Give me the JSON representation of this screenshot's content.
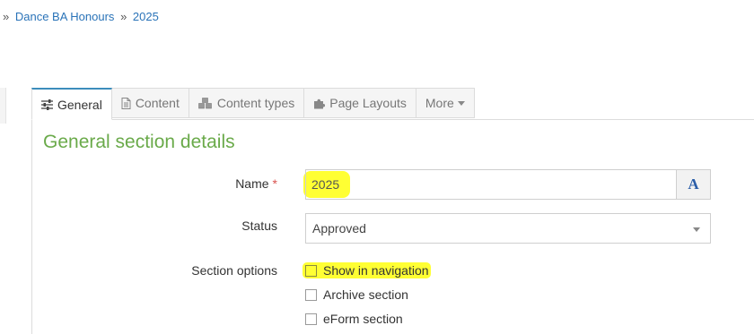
{
  "breadcrumb": {
    "separator": "»",
    "items": [
      "Dance BA Honours",
      "2025"
    ]
  },
  "tabs": [
    {
      "label": "General",
      "icon": "sliders-icon",
      "active": true
    },
    {
      "label": "Content",
      "icon": "file-icon",
      "active": false
    },
    {
      "label": "Content types",
      "icon": "cubes-icon",
      "active": false
    },
    {
      "label": "Page Layouts",
      "icon": "puzzle-icon",
      "active": false
    },
    {
      "label": "More",
      "icon": "caret-down-icon",
      "active": false
    }
  ],
  "section_title": "General section details",
  "form": {
    "name": {
      "label": "Name",
      "required_mark": "*",
      "value": "2025",
      "addon_label": "A"
    },
    "status": {
      "label": "Status",
      "value": "Approved"
    },
    "section_options": {
      "label": "Section options",
      "options": [
        {
          "label": "Show in navigation",
          "checked": false
        },
        {
          "label": "Archive section",
          "checked": false
        },
        {
          "label": "eForm section",
          "checked": false
        }
      ]
    }
  },
  "colors": {
    "link": "#2a73b8",
    "section_title": "#6aaa4a",
    "active_tab_border": "#3c8dbc",
    "required": "#d9534f",
    "highlight": "#ffff33"
  }
}
